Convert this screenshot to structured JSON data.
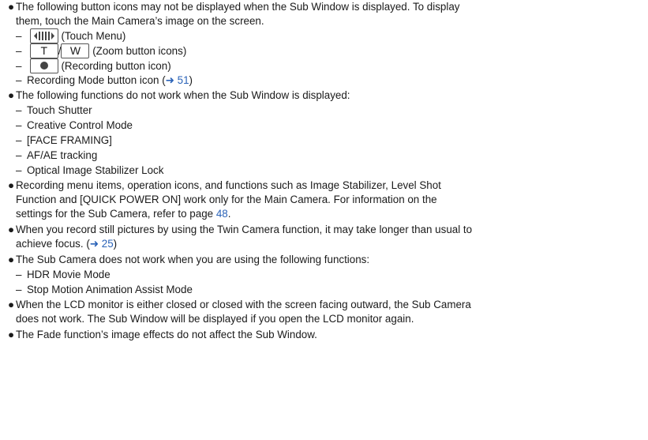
{
  "bullet": "●",
  "dash": "–",
  "arrow": "➜",
  "b1": {
    "line1": "The following button icons may not be displayed when the Sub Window is displayed. To display",
    "line2": "them, touch the Main Camera’s image on the screen.",
    "sub": {
      "touch_menu": "(Touch Menu)",
      "zoom_t": "T",
      "slash": "/",
      "zoom_w": "W",
      "zoom": "(Zoom button icons)",
      "recording": "(Recording button icon)",
      "mode": "Recording Mode button icon (",
      "mode_ref": "51",
      "close_paren": ")"
    }
  },
  "b2": {
    "line1": "The following functions do not work when the Sub Window is displayed:",
    "items": [
      "Touch Shutter",
      "Creative Control Mode",
      "[FACE FRAMING]",
      "AF/AE tracking",
      "Optical Image Stabilizer Lock"
    ]
  },
  "b3": {
    "line1": "Recording menu items, operation icons, and functions such as Image Stabilizer, Level Shot",
    "line2": "Function and [QUICK POWER ON] work only for the Main Camera. For information on the",
    "line3a": "settings for the Sub Camera, refer to page ",
    "line3_ref": "48",
    "line3b": "."
  },
  "b4": {
    "line1": "When you record still pictures by using the Twin Camera function, it may take longer than usual to",
    "line2a": "achieve focus. (",
    "line2_ref": "25",
    "line2b": ")"
  },
  "b5": {
    "line1": "The Sub Camera does not work when you are using the following functions:",
    "items": [
      "HDR Movie Mode",
      "Stop Motion Animation Assist Mode"
    ]
  },
  "b6": {
    "line1": "When the LCD monitor is either closed or closed with the screen facing outward, the Sub Camera",
    "line2": "does not work. The Sub Window will be displayed if you open the LCD monitor again."
  },
  "b7": {
    "line1": "The Fade function’s image effects do not affect the Sub Window."
  }
}
